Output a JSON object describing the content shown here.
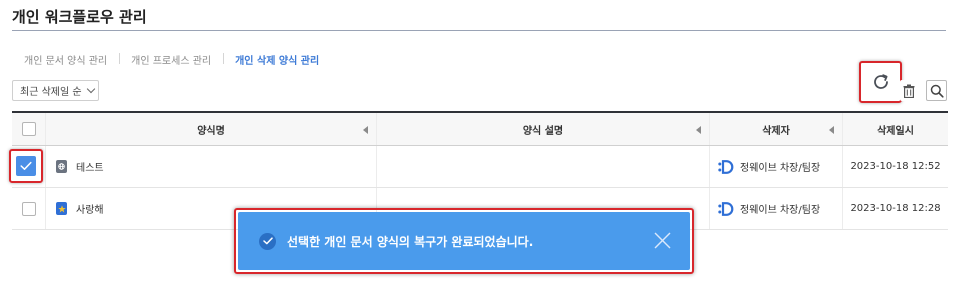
{
  "page": {
    "title": "개인 워크플로우 관리"
  },
  "tabs": [
    {
      "label": "개인 문서 양식 관리",
      "active": false
    },
    {
      "label": "개인 프로세스 관리",
      "active": false
    },
    {
      "label": "개인 삭제 양식 관리",
      "active": true
    }
  ],
  "sort": {
    "selected": "최근 삭제일 순"
  },
  "toolbar": {
    "refresh_icon": "refresh-icon",
    "trash_icon": "trash-icon",
    "search_icon": "search-icon"
  },
  "table": {
    "columns": [
      "양식명",
      "양식 설명",
      "삭제자",
      "삭제일시"
    ],
    "rows": [
      {
        "checked": true,
        "icon": "globe-doc-icon",
        "name": "테스트",
        "description": "",
        "deleted_by": "정웨이브 차장/팀장",
        "deleted_at": "2023-10-18 12:52"
      },
      {
        "checked": false,
        "icon": "star-doc-icon",
        "name": "사랑해",
        "description": "",
        "deleted_by": "정웨이브 차장/팀장",
        "deleted_at": "2023-10-18 12:28"
      }
    ]
  },
  "toast": {
    "message": "선택한 개인 문서 양식의 복구가 완료되었습니다."
  },
  "colors": {
    "accent": "#3d7ad6",
    "toast_bg": "#4a9bec",
    "highlight": "#d8262b",
    "checkbox": "#4a8ee6"
  }
}
